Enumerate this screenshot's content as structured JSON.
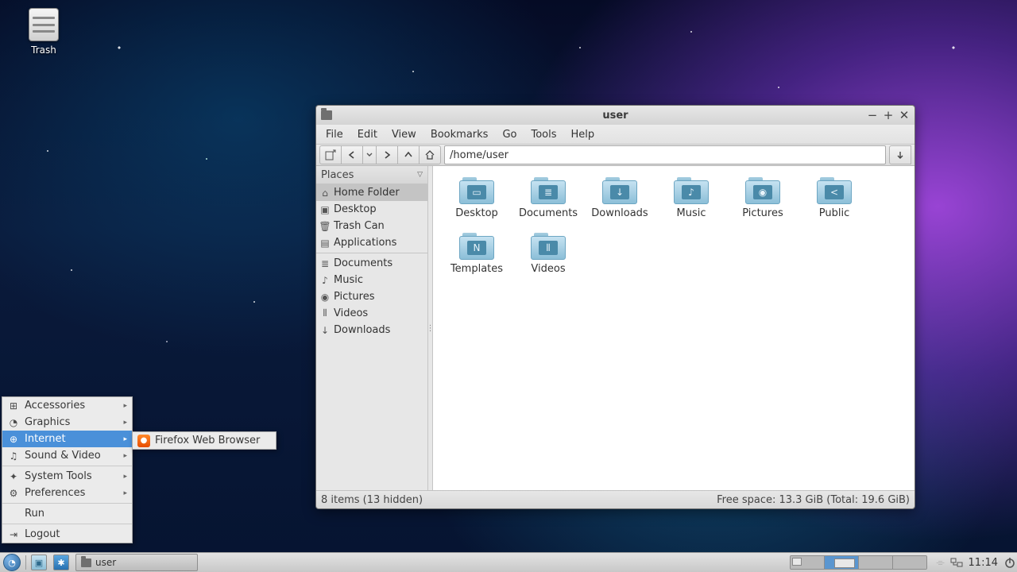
{
  "desktop": {
    "trash_label": "Trash"
  },
  "fm": {
    "title": "user",
    "menus": [
      "File",
      "Edit",
      "View",
      "Bookmarks",
      "Go",
      "Tools",
      "Help"
    ],
    "path": "/home/user",
    "sidebar": {
      "header": "Places",
      "group1": [
        {
          "icon": "home",
          "label": "Home Folder",
          "sel": true
        },
        {
          "icon": "desk",
          "label": "Desktop"
        },
        {
          "icon": "trash",
          "label": "Trash Can"
        },
        {
          "icon": "apps",
          "label": "Applications"
        }
      ],
      "group2": [
        {
          "icon": "docs",
          "label": "Documents"
        },
        {
          "icon": "music",
          "label": "Music"
        },
        {
          "icon": "pics",
          "label": "Pictures"
        },
        {
          "icon": "vids",
          "label": "Videos"
        },
        {
          "icon": "down",
          "label": "Downloads"
        }
      ]
    },
    "items": [
      {
        "label": "Desktop",
        "ov": "▭"
      },
      {
        "label": "Documents",
        "ov": "≣"
      },
      {
        "label": "Downloads",
        "ov": "↓"
      },
      {
        "label": "Music",
        "ov": "♪"
      },
      {
        "label": "Pictures",
        "ov": "◉"
      },
      {
        "label": "Public",
        "ov": "<"
      },
      {
        "label": "Templates",
        "ov": "N"
      },
      {
        "label": "Videos",
        "ov": "⦀"
      }
    ],
    "status_left": "8 items (13 hidden)",
    "status_right": "Free space: 13.3 GiB (Total: 19.6 GiB)"
  },
  "menu": {
    "items": [
      {
        "icon": "⊞",
        "label": "Accessories",
        "sub": true
      },
      {
        "icon": "◔",
        "label": "Graphics",
        "sub": true
      },
      {
        "icon": "⊕",
        "label": "Internet",
        "sub": true,
        "hl": true
      },
      {
        "icon": "♫",
        "label": "Sound & Video",
        "sub": true
      }
    ],
    "items2": [
      {
        "icon": "✦",
        "label": "System Tools",
        "sub": true
      },
      {
        "icon": "⚙",
        "label": "Preferences",
        "sub": true
      }
    ],
    "run": "Run",
    "logout": {
      "icon": "⇥",
      "label": "Logout"
    },
    "submenu": [
      {
        "label": "Firefox Web Browser"
      }
    ]
  },
  "panel": {
    "task_label": "user",
    "clock": "11:14"
  }
}
